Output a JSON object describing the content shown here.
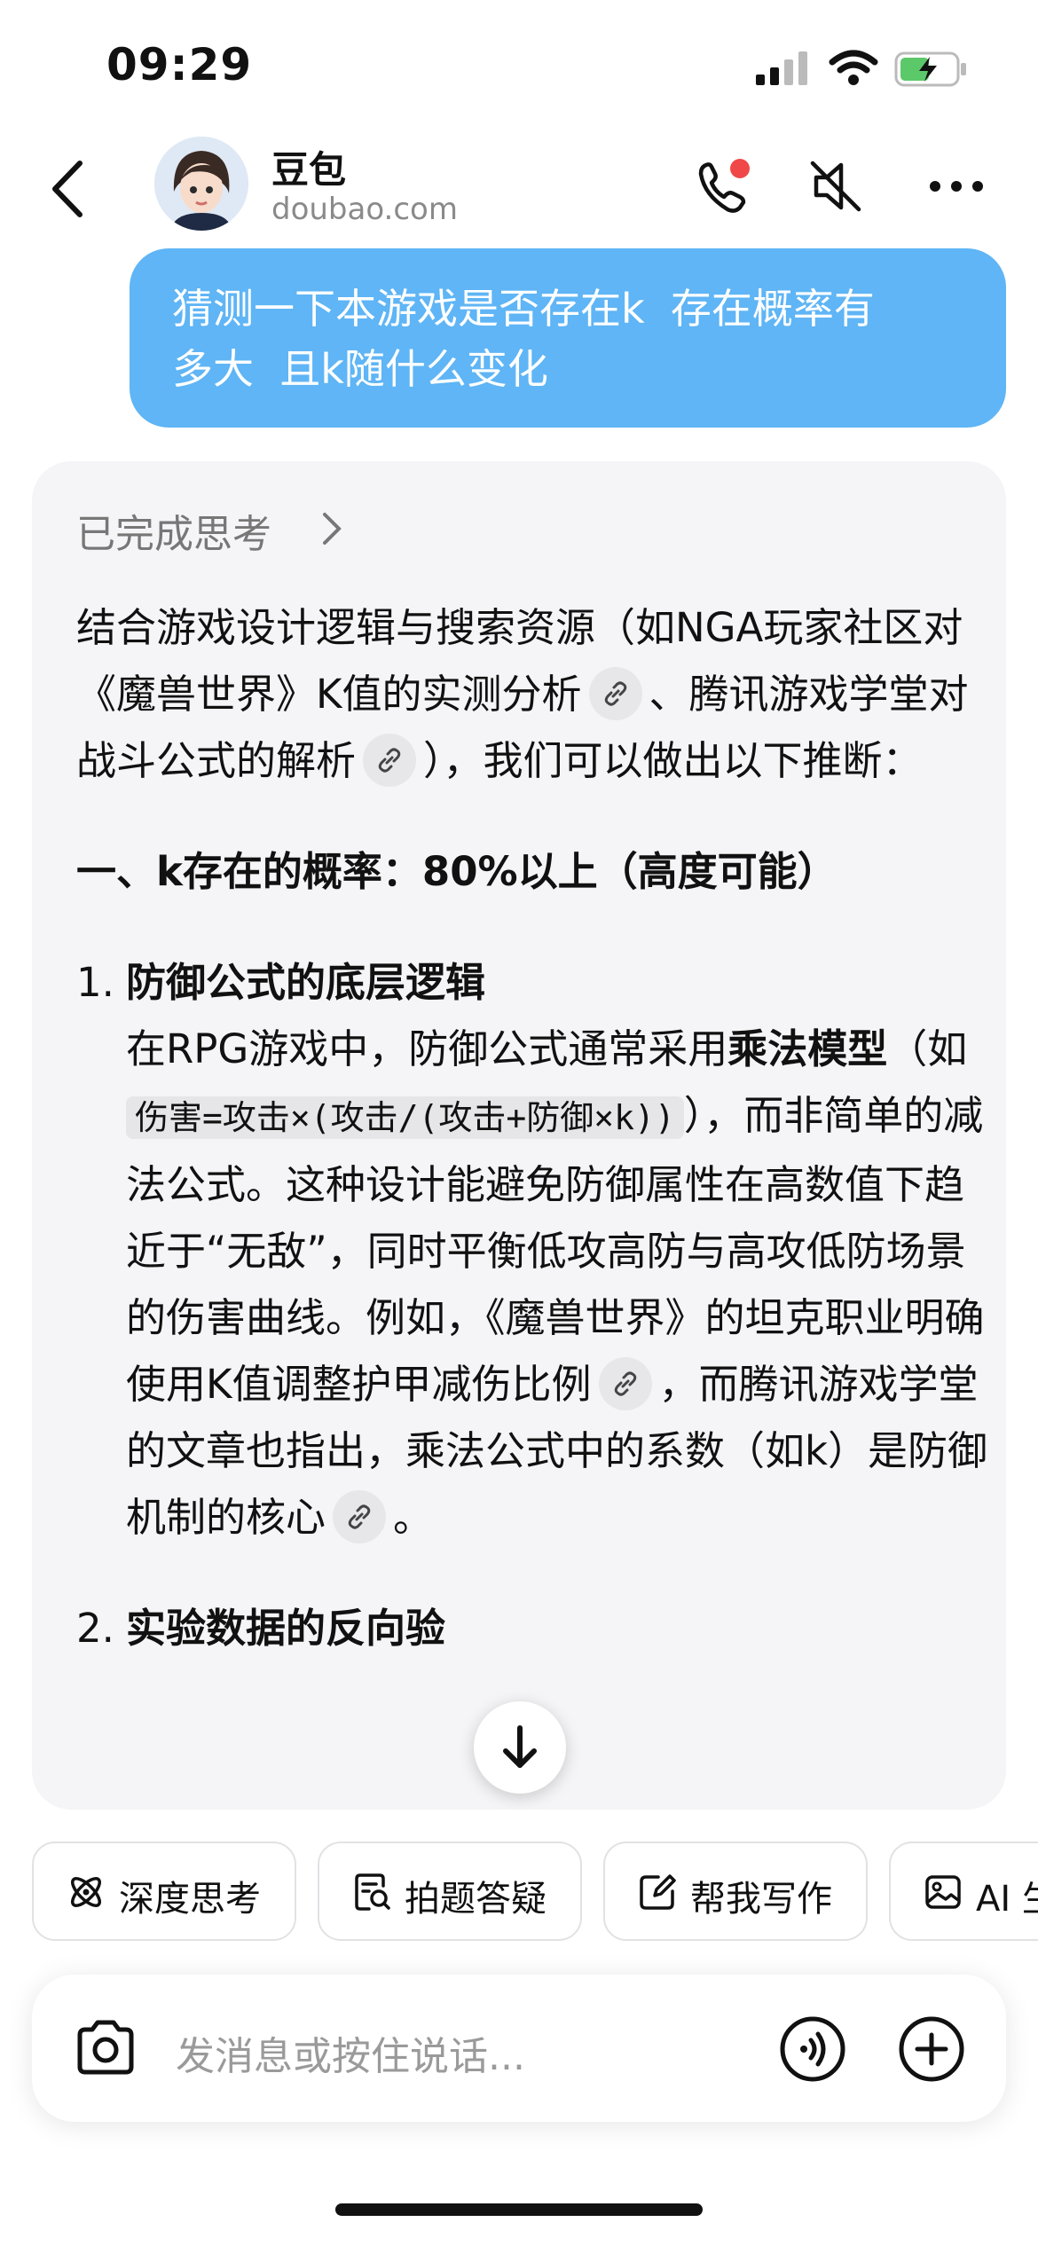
{
  "status_bar": {
    "time": "09:29"
  },
  "header": {
    "name": "豆包",
    "domain": "doubao.com"
  },
  "user_message": {
    "line1": "猜测一下本游戏是否存在k  存在概率有",
    "line2": "多大  且k随什么变化"
  },
  "answer": {
    "think_label": "已完成思考",
    "intro_1": "结合游戏设计逻辑与搜索资源（如NGA玩家社区对《魔兽世界》K值的实测分析",
    "intro_2": "、腾讯游戏学堂对战斗公式的解析",
    "intro_3": "），我们可以做出以下推断：",
    "section_title": "一、k存在的概率：80%以上（高度可能）",
    "item1_num": "1.",
    "item1_title": "防御公式的底层逻辑",
    "item1_text_a": "在RPG游戏中，防御公式通常采用",
    "item1_bold": "乘法模型",
    "item1_text_b": "（如",
    "item1_code": "伤害=攻击×(攻击/(攻击+防御×k))",
    "item1_text_c": "），而非简单的减法公式。这种设计能避免防御属性在高数值下趋近于“无敌”，同时平衡低攻高防与高攻低防场景的伤害曲线。例如，《魔兽世界》的坦克职业明确使用K值调整护甲减伤比例",
    "item1_text_d": "，而腾讯游戏学堂的文章也指出，乘法公式中的系数（如k）是防御机制的核心",
    "item1_text_e": "。",
    "item2_num": "2.",
    "item2_title": "实验数据的反向验"
  },
  "chips": [
    {
      "label": "深度思考",
      "icon": "atom-icon"
    },
    {
      "label": "拍题答疑",
      "icon": "photo-question-icon"
    },
    {
      "label": "帮我写作",
      "icon": "edit-icon"
    },
    {
      "label": "AI 生",
      "icon": "image-icon"
    }
  ],
  "input": {
    "placeholder": "发消息或按住说话..."
  },
  "colors": {
    "bubble": "#5fb5f5",
    "card": "#f5f5f7",
    "call_dot": "#f04848",
    "battery": "#5bc86a"
  }
}
